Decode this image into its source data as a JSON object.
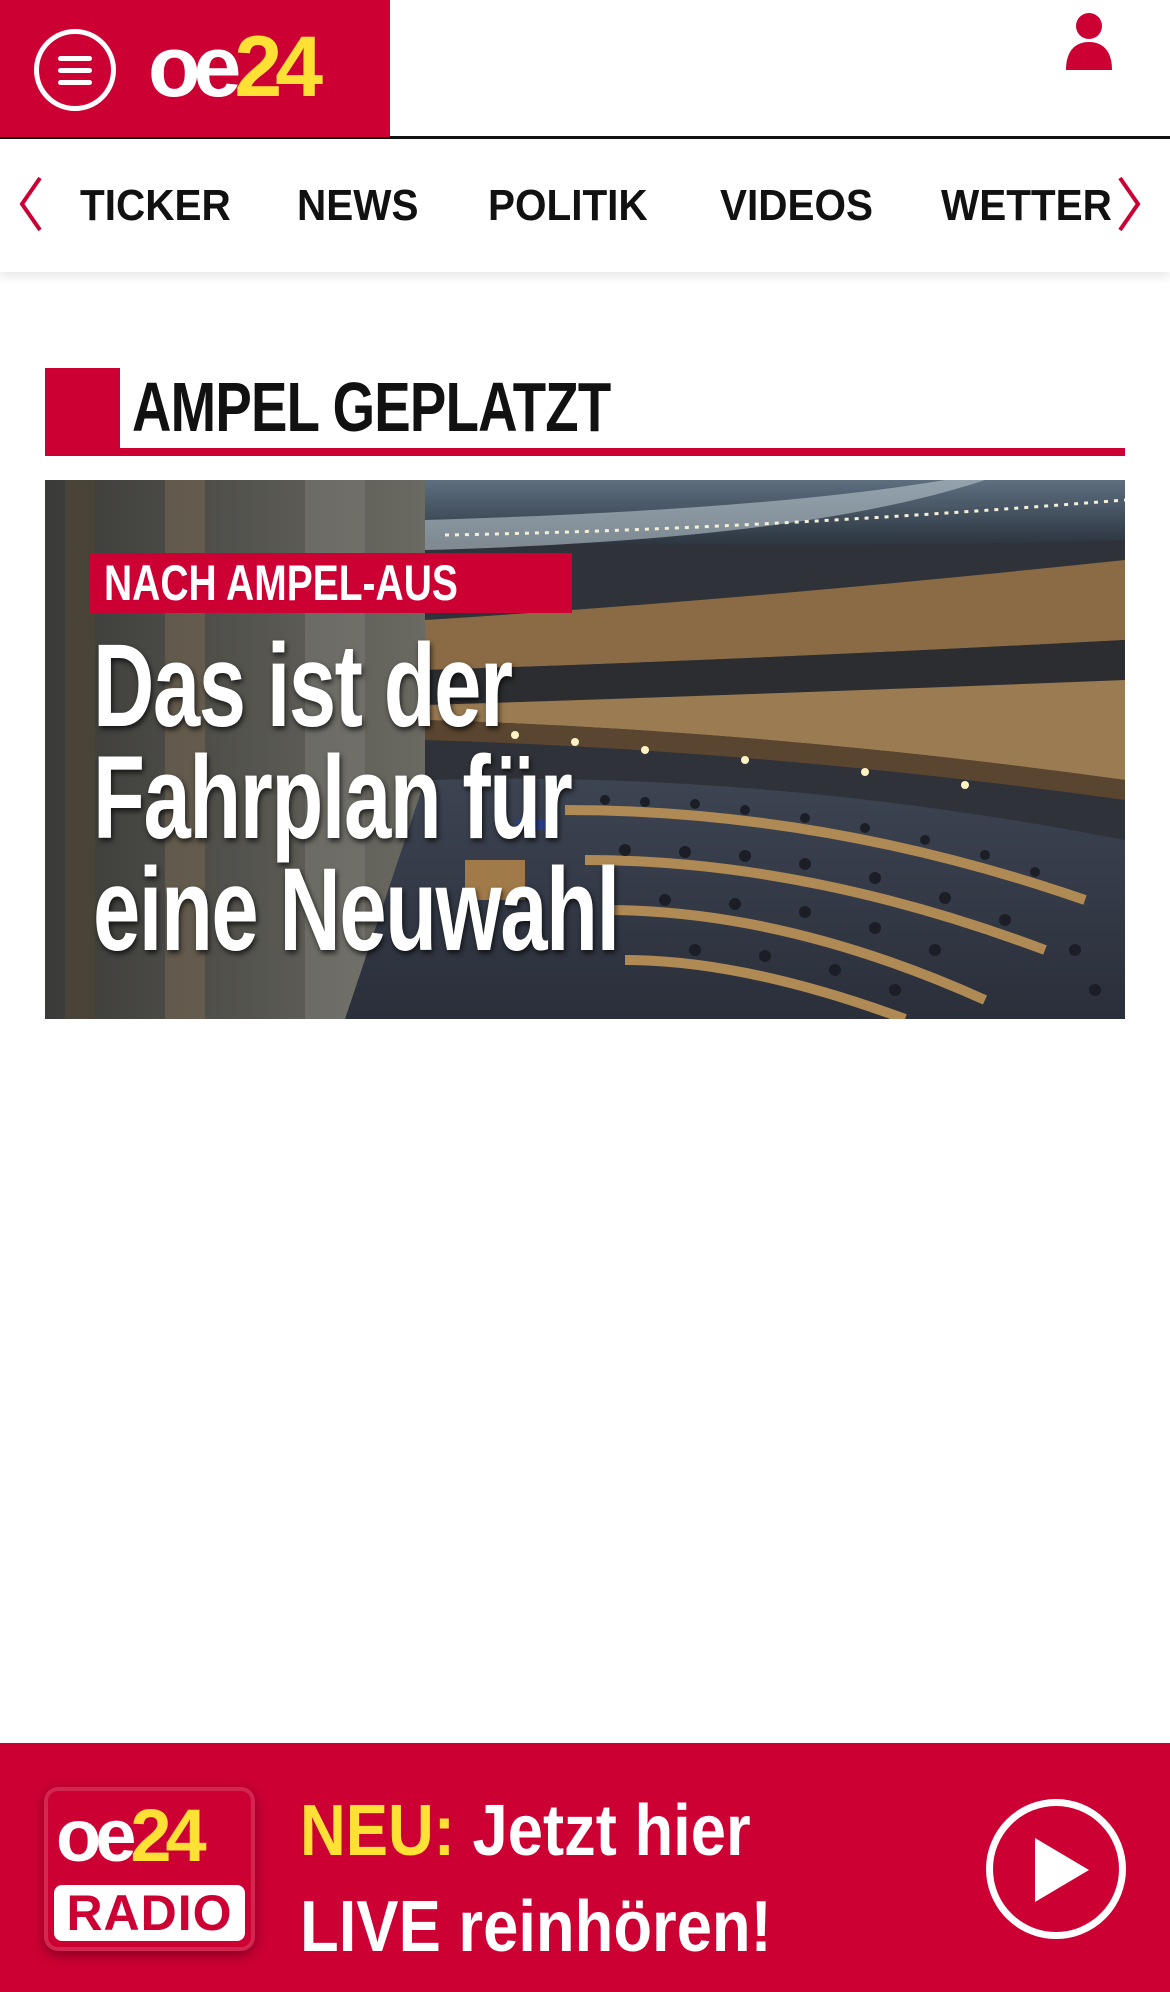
{
  "header": {
    "menu_icon": "hamburger-menu-icon",
    "logo_part1": "oe",
    "logo_part2": "24",
    "user_icon": "user-icon",
    "colors": {
      "brand_red": "#cc0033",
      "logo_yellow": "#ffe135"
    }
  },
  "nav": {
    "items": [
      {
        "label": "TICKER"
      },
      {
        "label": "NEWS"
      },
      {
        "label": "POLITIK"
      },
      {
        "label": "VIDEOS"
      },
      {
        "label": "WETTER"
      }
    ],
    "left_arrow_icon": "chevron-left-icon",
    "right_arrow_icon": "chevron-right-icon"
  },
  "section": {
    "title": "AMPEL GEPLATZT"
  },
  "hero": {
    "kicker": "NACH AMPEL-AUS",
    "headline_lines": [
      "Das ist der",
      "Fahrplan für",
      "eine Neuwahl"
    ]
  },
  "radio_banner": {
    "logo_part1": "oe",
    "logo_part2": "24",
    "logo_label": "RADIO",
    "neu": "NEU:",
    "line1_rest": " Jetzt hier",
    "line2": "LIVE reinhören!",
    "play_icon": "play-icon"
  }
}
